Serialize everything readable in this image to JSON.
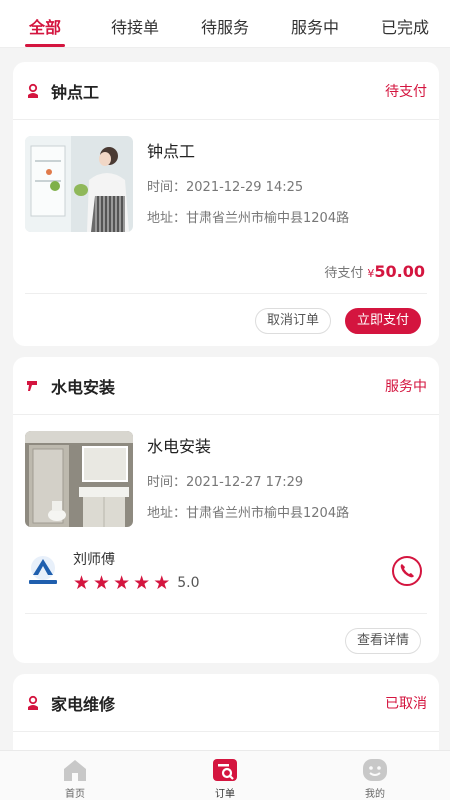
{
  "tabs": [
    {
      "label": "全部",
      "active": true
    },
    {
      "label": "待接单",
      "active": false
    },
    {
      "label": "待服务",
      "active": false
    },
    {
      "label": "服务中",
      "active": false
    },
    {
      "label": "已完成",
      "active": false
    }
  ],
  "orders": [
    {
      "service": "钟点工",
      "status": "待支付",
      "title": "钟点工",
      "time": "时间：2021-12-29 14:25",
      "address": "地址：甘肃省兰州市榆中县1204路",
      "price_label": "待支付",
      "currency": "¥",
      "amount": "50.00",
      "buttons": {
        "cancel": "取消订单",
        "pay": "立即支付"
      }
    },
    {
      "service": "水电安装",
      "status": "服务中",
      "title": "水电安装",
      "time": "时间：2021-12-27 17:29",
      "address": "地址：甘肃省兰州市榆中县1204路",
      "worker": {
        "name": "刘师傅",
        "rating": "5.0",
        "stars": 5
      },
      "buttons": {
        "detail": "查看详情"
      }
    },
    {
      "service": "家电维修",
      "status": "已取消"
    }
  ],
  "nav": [
    {
      "label": "首页",
      "icon": "home-icon"
    },
    {
      "label": "订单",
      "icon": "orders-icon"
    },
    {
      "label": "我的",
      "icon": "profile-icon"
    }
  ],
  "colors": {
    "accent": "#d4153f",
    "background": "#f4f4f4"
  }
}
